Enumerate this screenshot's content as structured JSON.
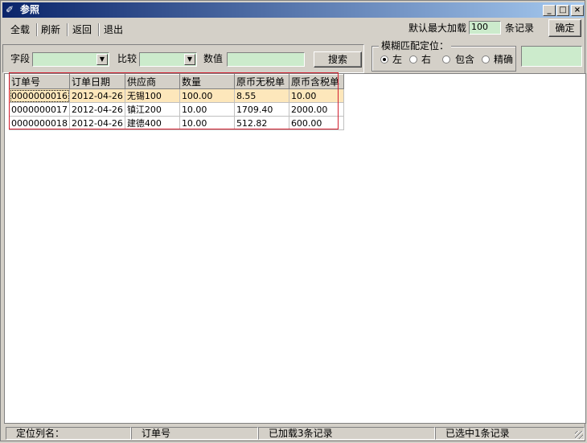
{
  "window": {
    "title": "参照"
  },
  "toolbar": {
    "load_all": "全载",
    "refresh": "刷新",
    "back": "返回",
    "exit": "退出",
    "max_load_label": "默认最大加载",
    "max_load_value": "100",
    "records_label": "条记录",
    "confirm": "确定"
  },
  "filter": {
    "field_label": "字段",
    "field_value": "",
    "compare_label": "比较",
    "compare_value": "",
    "value_label": "数值",
    "value_value": "",
    "search_button": "搜索"
  },
  "fuzzy": {
    "title": "模糊匹配定位：",
    "options": [
      "左",
      "右",
      "包含",
      "精确"
    ],
    "selected": "左",
    "value": ""
  },
  "table": {
    "columns": [
      "订单号",
      "订单日期",
      "供应商",
      "数量",
      "原币无税单",
      "原币含税单"
    ],
    "rows": [
      [
        "0000000016",
        "2012-04-26",
        "无锡100",
        "100.00",
        "8.55",
        "10.00"
      ],
      [
        "0000000017",
        "2012-04-26",
        "镇江200",
        "10.00",
        "1709.40",
        "2000.00"
      ],
      [
        "0000000018",
        "2012-04-26",
        "建德400",
        "10.00",
        "512.82",
        "600.00"
      ]
    ]
  },
  "status": {
    "locate_col_label": "定位列名：",
    "locate_col_value": "订单号",
    "loaded": "已加载3条记录",
    "selected": "已选中1条记录"
  },
  "colors": {
    "title_start": "#0a246a",
    "input_bg": "#ccebcc",
    "selected_row": "#fde7bb",
    "highlight_box": "#d21f2f"
  }
}
